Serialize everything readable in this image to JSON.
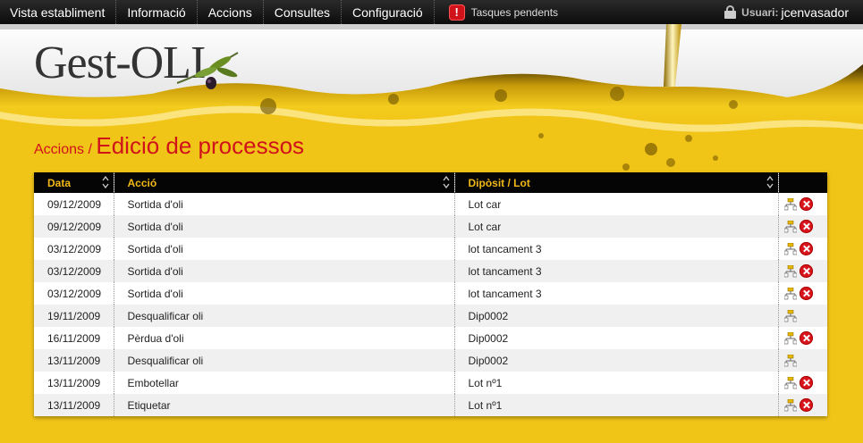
{
  "nav": {
    "items": [
      {
        "label": "Vista establiment"
      },
      {
        "label": "Informació"
      },
      {
        "label": "Accions"
      },
      {
        "label": "Consultes"
      },
      {
        "label": "Configuració"
      }
    ],
    "tasks_label": "Tasques pendents",
    "tasks_icon": "!",
    "user_label": "Usuari:",
    "user_name": "jcenvasador"
  },
  "logo": {
    "text": "Gest-OLI"
  },
  "breadcrumb": {
    "parent": "Accions",
    "separator": " / ",
    "title": "Edició de processos"
  },
  "table": {
    "columns": [
      "Data",
      "Acció",
      "Dipòsit / Lot",
      ""
    ],
    "rows": [
      {
        "date": "09/12/2009",
        "action": "Sortida d'oli",
        "lot": "Lot car",
        "delete": true
      },
      {
        "date": "09/12/2009",
        "action": "Sortida d'oli",
        "lot": "Lot car",
        "delete": true
      },
      {
        "date": "03/12/2009",
        "action": "Sortida d'oli",
        "lot": "lot tancament 3",
        "delete": true
      },
      {
        "date": "03/12/2009",
        "action": "Sortida d'oli",
        "lot": "lot tancament 3",
        "delete": true
      },
      {
        "date": "03/12/2009",
        "action": "Sortida d'oli",
        "lot": "lot tancament 3",
        "delete": true
      },
      {
        "date": "19/11/2009",
        "action": "Desqualificar oli",
        "lot": "Dip0002",
        "delete": false
      },
      {
        "date": "16/11/2009",
        "action": "Pèrdua d'oli",
        "lot": "Dip0002",
        "delete": true
      },
      {
        "date": "13/11/2009",
        "action": "Desqualificar oli",
        "lot": "Dip0002",
        "delete": false
      },
      {
        "date": "13/11/2009",
        "action": "Embotellar",
        "lot": "Lot nº1",
        "delete": true
      },
      {
        "date": "13/11/2009",
        "action": "Etiquetar",
        "lot": "Lot nº1",
        "delete": true
      }
    ]
  },
  "colors": {
    "accent_red": "#d0121b",
    "header_gold": "#f2b818",
    "oil_yellow": "#f1c418"
  }
}
